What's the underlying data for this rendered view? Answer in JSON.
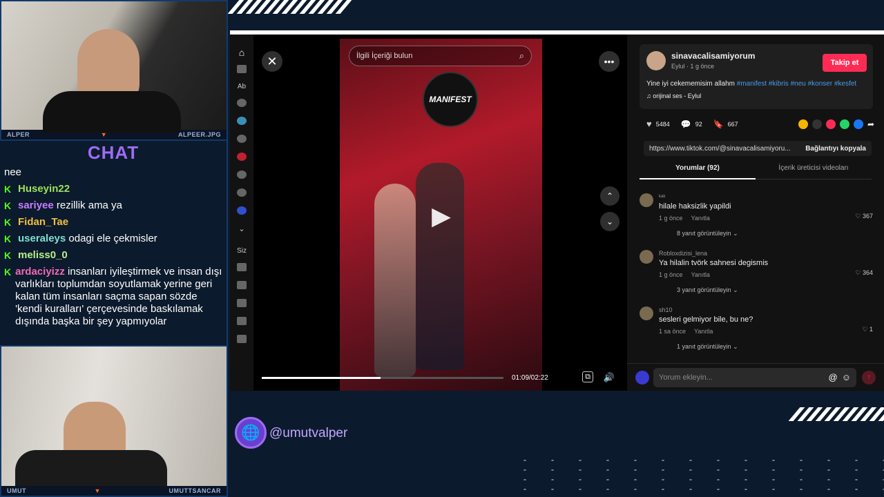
{
  "overlay": {
    "webcam_top": {
      "left_label": "ALPER",
      "right_label": "ALPEER.JPG"
    },
    "webcam_bottom": {
      "left_label": "UMUT",
      "right_label": "UMUTTSANCAR"
    },
    "handle": "@umutvalper",
    "colors": {
      "bg": "#0c1a2d",
      "accent": "#9d6cf4",
      "kick": "#53fc18"
    }
  },
  "chat": {
    "title": "CHAT",
    "first_line": "nee",
    "messages": [
      {
        "user": "Huseyin22",
        "color": "#9be35a",
        "text": ""
      },
      {
        "user": "sariyee",
        "color": "#c77dff",
        "text": "rezillik ama ya"
      },
      {
        "user": "Fidan_Tae",
        "color": "#f0c040",
        "text": ""
      },
      {
        "user": "useraleys",
        "color": "#7ee0d0",
        "text": "odagi ele çekmisler"
      },
      {
        "user": "meliss0_0",
        "color": "#b8f08a",
        "text": ""
      },
      {
        "user": "ardaciyizz",
        "color": "#f06ab4",
        "text": "insanları iyileştirmek ve insan dışı varlıkları toplumdan soyutlamak yerine geri kalan tüm insanları saçma sapan sözde 'kendi kuralları' çerçevesinde baskılamak dışında başka bir şey yapmıyolar"
      }
    ]
  },
  "sidebar": {
    "section_a": "Ab",
    "section_b": "Siz"
  },
  "video": {
    "search_placeholder": "İlgili İçeriği bulun",
    "stage_sign": "MANIFEST",
    "time": "01:09/02:22",
    "progress": 0.49
  },
  "post": {
    "username": "sinavacalisamiyorum",
    "subline": "Eylul · 1 g önce",
    "follow_label": "Takip et",
    "caption": "Yine iyi cekememisim allahm",
    "hashtags": "#manifest #kibris #neu #konser #kesfet",
    "sound": "orijinal ses - Eylul",
    "likes": "5484",
    "comments": "92",
    "saves": "667",
    "link": "https://www.tiktok.com/@sinavacalisamiyoru...",
    "copy_label": "Bağlantıyı kopyala",
    "tab_comments": "Yorumlar (92)",
    "tab_creator": "İçerik üreticisi videoları",
    "comment_placeholder": "Yorum ekleyin..."
  },
  "comments": [
    {
      "name": "ᵏᵃᵏ",
      "text": "hilale haksizlik yapildi",
      "time": "1 g önce",
      "reply": "Yanıtla",
      "likes": "367",
      "view": "8 yanıt görüntüleyin"
    },
    {
      "name": "Robloxdizisi_lena",
      "text": "Ya hilalin tvörk sahnesi degismis",
      "time": "1 g önce",
      "reply": "Yanıtla",
      "likes": "364",
      "view": "3 yanıt görüntüleyin"
    },
    {
      "name": "sh10",
      "text": "sesleri gelmiyor bile, bu ne?",
      "time": "1 sa önce",
      "reply": "Yanıtla",
      "likes": "1",
      "view": "1 yanıt görüntüleyin"
    }
  ]
}
